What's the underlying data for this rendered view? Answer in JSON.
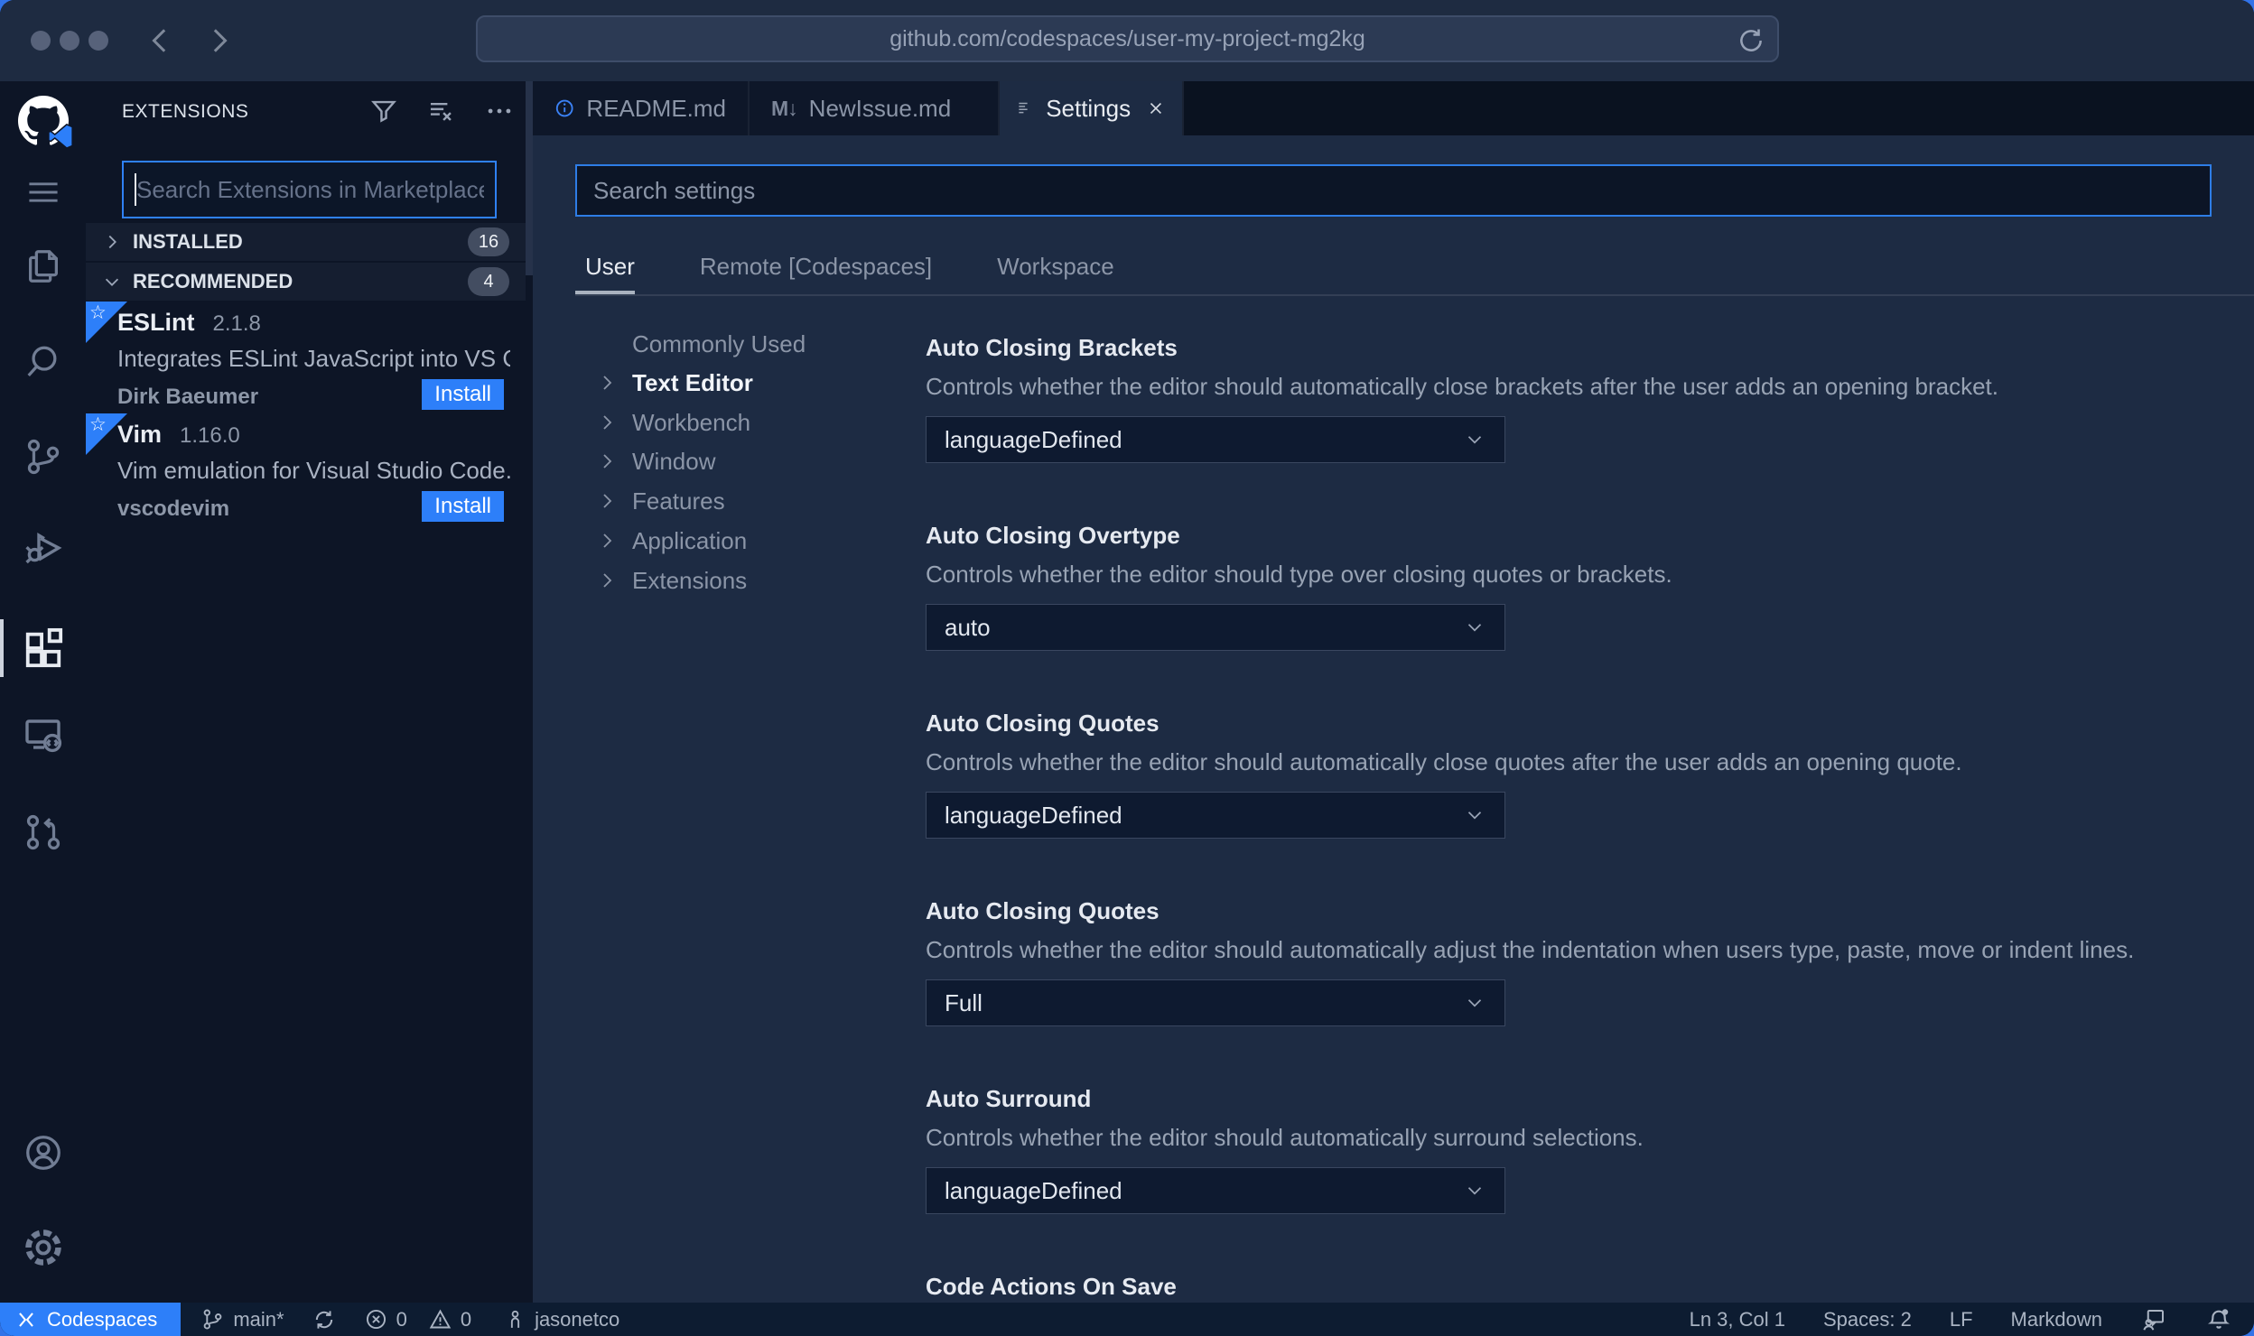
{
  "window": {
    "url": "github.com/codespaces/user-my-project-mg2kg"
  },
  "activity_bar": {
    "icons": [
      "github-codespaces-logo",
      "menu",
      "explorer",
      "search",
      "source-control",
      "run-and-debug",
      "extensions",
      "remote-explorer",
      "github-pull-requests",
      "account",
      "manage-settings"
    ]
  },
  "sidebar": {
    "title": "EXTENSIONS",
    "search": {
      "placeholder": "Search Extensions in Marketplace"
    },
    "sections": [
      {
        "label": "INSTALLED",
        "badge": "16"
      },
      {
        "label": "RECOMMENDED",
        "badge": "4"
      }
    ],
    "extensions": [
      {
        "name": "ESLint",
        "version": "2.1.8",
        "description": "Integrates ESLint JavaScript into VS C...",
        "author": "Dirk Baeumer",
        "action": "Install"
      },
      {
        "name": "Vim",
        "version": "1.16.0",
        "description": "Vim emulation for Visual Studio Code...",
        "author": "vscodevim",
        "action": "Install"
      }
    ]
  },
  "editor": {
    "tabs": [
      {
        "label": "README.md"
      },
      {
        "label": "NewIssue.md"
      },
      {
        "label": "Settings"
      }
    ],
    "settings": {
      "search_placeholder": "Search settings",
      "scopes": [
        "User",
        "Remote [Codespaces]",
        "Workspace"
      ],
      "toc": [
        "Commonly Used",
        "Text Editor",
        "Workbench",
        "Window",
        "Features",
        "Application",
        "Extensions"
      ],
      "items": [
        {
          "title": "Auto Closing Brackets",
          "description": "Controls whether the editor should automatically close brackets after the user adds an opening bracket.",
          "value": "languageDefined"
        },
        {
          "title": "Auto Closing Overtype",
          "description": "Controls whether the editor should type over closing quotes or brackets.",
          "value": "auto"
        },
        {
          "title": "Auto Closing Quotes",
          "description": "Controls whether the editor should automatically close quotes after the user adds an opening quote.",
          "value": "languageDefined"
        },
        {
          "title": "Auto Closing Quotes",
          "description": "Controls whether the editor should automatically adjust the indentation when users type, paste, move or indent lines.",
          "value": "Full"
        },
        {
          "title": "Auto Surround",
          "description": "Controls whether the editor should automatically surround selections.",
          "value": "languageDefined"
        },
        {
          "title": "Code Actions On Save"
        }
      ]
    }
  },
  "status_bar": {
    "remote_label": "Codespaces",
    "branch": "main*",
    "errors": "0",
    "warnings": "0",
    "user": "jasonetco",
    "cursor_position": "Ln 3, Col 1",
    "indentation": "Spaces: 2",
    "eol": "LF",
    "language": "Markdown"
  },
  "glyphs": {
    "markdown_icon": "M↓",
    "star": "☆"
  },
  "colors": {
    "accent": "#2d7ff9",
    "desktop": "#3273e8",
    "editor_bg": "#1d2b43",
    "sidebar_bg": "#0d1526",
    "titlebar_bg": "#1e2b41",
    "statusbar_bg": "#0d1c31"
  }
}
